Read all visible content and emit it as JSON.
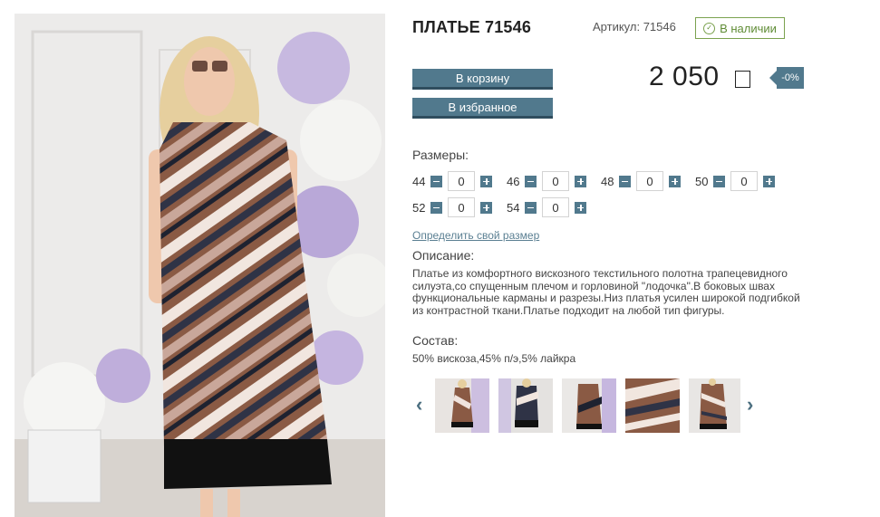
{
  "product": {
    "title": "ПЛАТЬЕ 71546",
    "sku": "Артикул: 71546",
    "stock": "В наличии",
    "price": "2 050",
    "discount": "-0%"
  },
  "buttons": {
    "cart": "В корзину",
    "favorite": "В избранное"
  },
  "sizes": {
    "label": "Размеры:",
    "items": [
      {
        "size": "44",
        "qty": "0"
      },
      {
        "size": "46",
        "qty": "0"
      },
      {
        "size": "48",
        "qty": "0"
      },
      {
        "size": "50",
        "qty": "0"
      },
      {
        "size": "52",
        "qty": "0"
      },
      {
        "size": "54",
        "qty": "0"
      }
    ]
  },
  "size_link": "Определить свой размер",
  "description": {
    "label": "Описание:",
    "lines": [
      "Платье из комфортного вискозного текстильного полотна трапецевидного",
      "силуэта,со спущенным плечом и горловиной \"лодочка\".В боковых швах",
      "функциональные карманы и разрезы.Низ платья усилен широкой подгибкой",
      "из контрастной ткани.Платье подходит на любой тип фигуры."
    ]
  },
  "composition": {
    "label": "Состав:",
    "text": "50% вискоза,45% п/э,5% лайкра"
  },
  "gallery": {
    "prev_icon": "chevron-left-icon",
    "next_icon": "chevron-right-icon",
    "thumbnails": [
      "thumb-1",
      "thumb-2",
      "thumb-3",
      "thumb-4",
      "thumb-5"
    ]
  },
  "colors": {
    "accent": "#51798d",
    "stock_green": "#7ba24f"
  }
}
